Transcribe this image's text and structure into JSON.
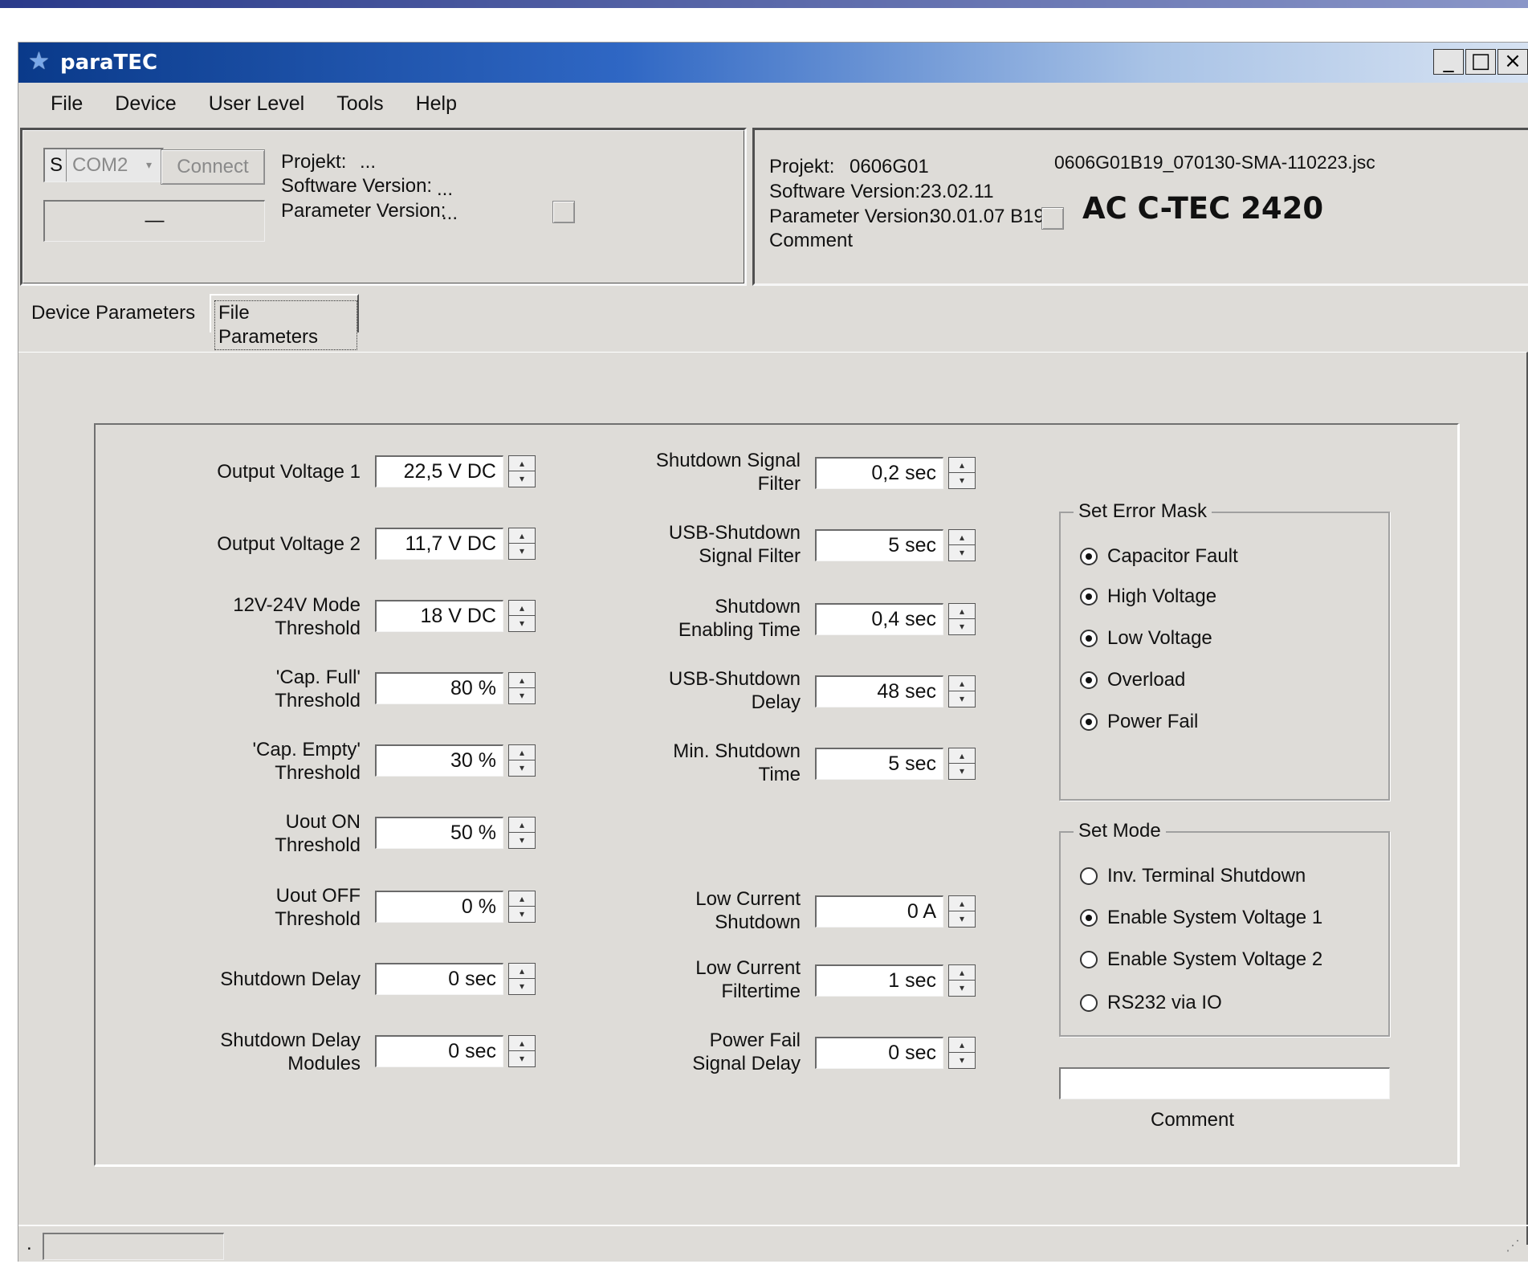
{
  "window": {
    "title": "paraTEC",
    "min_glyph": "_",
    "max_glyph": "□",
    "close_glyph": "×"
  },
  "menu": [
    "File",
    "Device",
    "User Level",
    "Tools",
    "Help"
  ],
  "connection": {
    "port_prefix": "S",
    "port": "COM2",
    "connect_label": "Connect",
    "status": "—",
    "projekt_label": "Projekt:",
    "projekt_value": "...",
    "software_label": "Software Version:",
    "software_value": "...",
    "parameter_label": "Parameter Version:",
    "parameter_value": "..."
  },
  "file_info": {
    "projekt_label": "Projekt:",
    "projekt_value": "0606G01",
    "software_label": "Software Version:",
    "software_value": "23.02.11",
    "parameter_label": "Parameter Version:",
    "parameter_value": "30.01.07 B19",
    "comment_label": "Comment",
    "filename": "0606G01B19_070130-SMA-110223.jsc",
    "device_name": "AC C-TEC 2420"
  },
  "tabs": [
    "Device Parameters",
    "File Parameters"
  ],
  "params_left": [
    {
      "label": [
        "Output Voltage 1"
      ],
      "value": "22,5 V DC"
    },
    {
      "label": [
        "Output Voltage 2"
      ],
      "value": "11,7 V DC"
    },
    {
      "label": [
        "12V-24V Mode",
        "Threshold"
      ],
      "value": "18 V DC"
    },
    {
      "label": [
        "'Cap. Full'",
        "Threshold"
      ],
      "value": "80 %"
    },
    {
      "label": [
        "'Cap. Empty'",
        "Threshold"
      ],
      "value": "30 %"
    },
    {
      "label": [
        "Uout ON",
        "Threshold"
      ],
      "value": "50 %"
    },
    {
      "label": [
        "Uout OFF",
        "Threshold"
      ],
      "value": "0 %"
    },
    {
      "label": [
        "Shutdown Delay"
      ],
      "value": "0 sec"
    },
    {
      "label": [
        "Shutdown Delay",
        "Modules"
      ],
      "value": "0 sec"
    }
  ],
  "params_mid": [
    {
      "label": [
        "Shutdown Signal",
        "Filter"
      ],
      "value": "0,2 sec"
    },
    {
      "label": [
        "USB-Shutdown",
        "Signal Filter"
      ],
      "value": "5 sec"
    },
    {
      "label": [
        "Shutdown",
        "Enabling Time"
      ],
      "value": "0,4 sec"
    },
    {
      "label": [
        "USB-Shutdown",
        "Delay"
      ],
      "value": "48 sec"
    },
    {
      "label": [
        "Min. Shutdown",
        "Time"
      ],
      "value": "5 sec"
    },
    {
      "label": [
        "Low Current",
        "Shutdown"
      ],
      "value": "0 A"
    },
    {
      "label": [
        "Low Current",
        "Filtertime"
      ],
      "value": "1 sec"
    },
    {
      "label": [
        "Power Fail",
        "Signal Delay"
      ],
      "value": "0 sec"
    }
  ],
  "error_mask": {
    "title": "Set Error Mask",
    "options": [
      {
        "label": "Capacitor Fault",
        "checked": true
      },
      {
        "label": "High Voltage",
        "checked": true
      },
      {
        "label": "Low Voltage",
        "checked": true
      },
      {
        "label": "Overload",
        "checked": true
      },
      {
        "label": "Power Fail",
        "checked": true
      }
    ]
  },
  "mode": {
    "title": "Set Mode",
    "options": [
      {
        "label": "Inv. Terminal Shutdown",
        "checked": false
      },
      {
        "label": "Enable System Voltage 1",
        "checked": true
      },
      {
        "label": "Enable System Voltage 2",
        "checked": false
      },
      {
        "label": "RS232 via IO",
        "checked": false
      }
    ]
  },
  "comment_box": {
    "value": "",
    "label": "Comment"
  },
  "status": {
    "dot": "."
  }
}
